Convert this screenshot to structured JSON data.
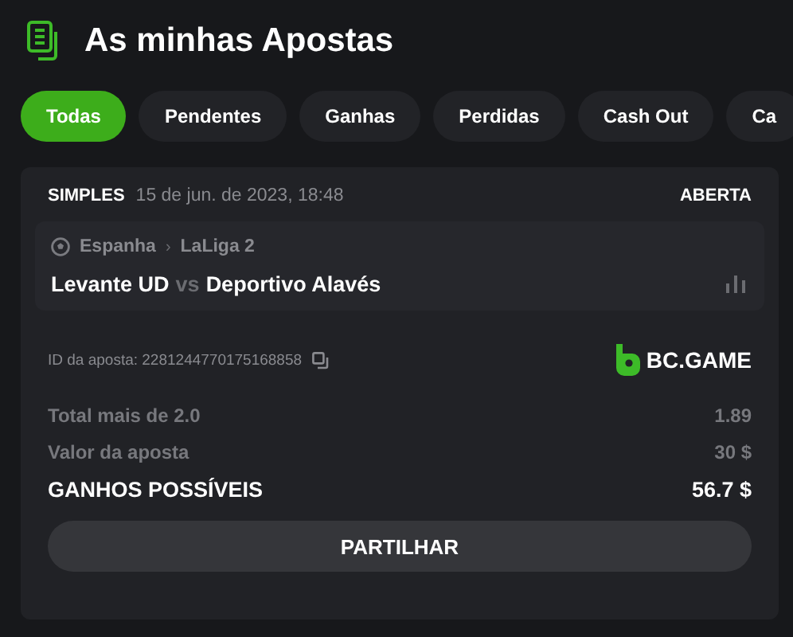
{
  "header": {
    "title": "As minhas Apostas"
  },
  "tabs": [
    {
      "label": "Todas",
      "selected": true
    },
    {
      "label": "Pendentes",
      "selected": false
    },
    {
      "label": "Ganhas",
      "selected": false
    },
    {
      "label": "Perdidas",
      "selected": false
    },
    {
      "label": "Cash Out",
      "selected": false
    },
    {
      "label": "Ca",
      "selected": false
    }
  ],
  "bet": {
    "type": "SIMPLES",
    "date": "15 de jun. de 2023, 18:48",
    "status": "ABERTA",
    "event": {
      "country": "Espanha",
      "separator": "›",
      "league": "LaLiga 2",
      "home": "Levante UD",
      "vs": "vs",
      "away": "Deportivo Alavés"
    },
    "id_label": "ID da aposta: 2281244770175168858",
    "brand": "BC.GAME",
    "rows": [
      {
        "kind": "detail",
        "label": "Total mais de 2.0",
        "value": "1.89"
      },
      {
        "kind": "detail",
        "label": "Valor da aposta",
        "value": "30 $"
      },
      {
        "kind": "total",
        "label": "GANHOS POSSÍVEIS",
        "value": "56.7 $"
      }
    ],
    "share_button": "PARTILHAR"
  }
}
